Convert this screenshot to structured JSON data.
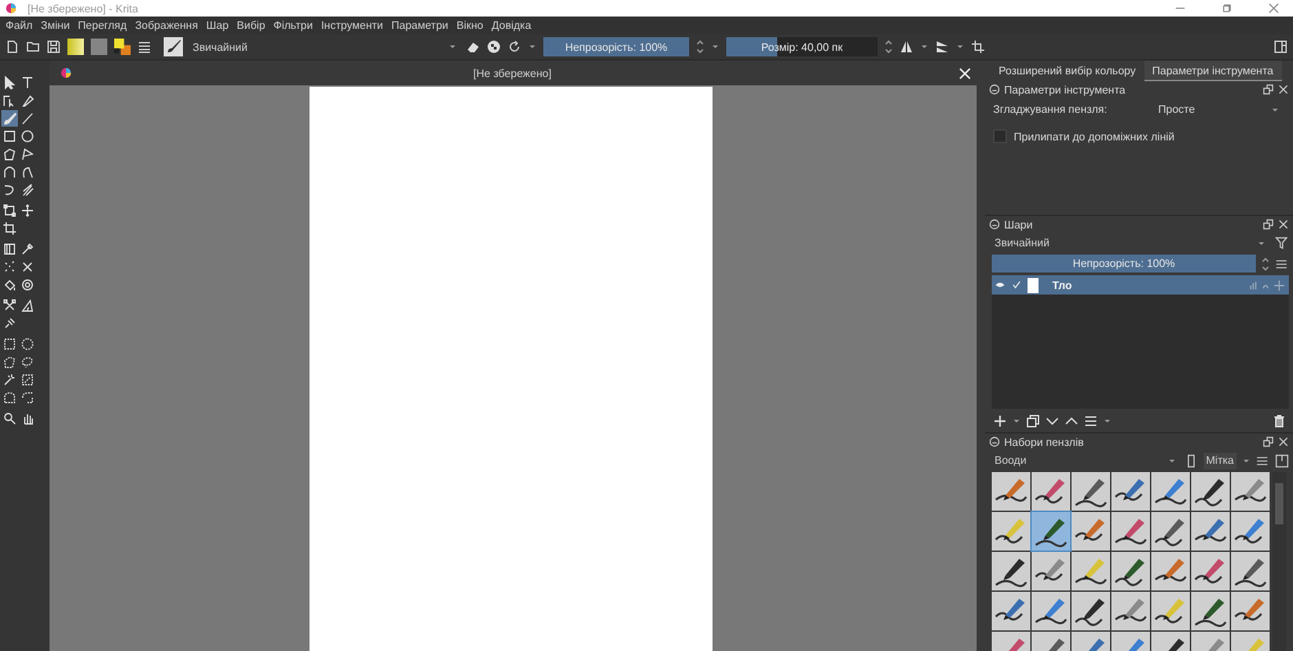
{
  "window": {
    "title": "[Не збережено] - Krita"
  },
  "menu": [
    "Файл",
    "Зміни",
    "Перегляд",
    "Зображення",
    "Шар",
    "Вибір",
    "Фільтри",
    "Інструменти",
    "Параметри",
    "Вікно",
    "Довідка"
  ],
  "toolbar": {
    "blend_mode": "Звичайний",
    "opacity": {
      "label": "Непрозорість: 100%",
      "level": 1
    },
    "size": {
      "label": "Розмір: 40,00 пк",
      "level": 0.34
    }
  },
  "toolbox": [
    [
      {
        "kind": "select",
        "selected": false
      },
      {
        "kind": "text",
        "selected": false
      },
      {
        "kind": "shape-edit",
        "selected": false
      },
      {
        "kind": "calligraphy",
        "selected": false
      },
      {
        "kind": "brush",
        "selected": true
      },
      {
        "kind": "line",
        "selected": false
      },
      {
        "kind": "rect",
        "selected": false
      },
      {
        "kind": "ellipse",
        "selected": false
      },
      {
        "kind": "polygon",
        "selected": false
      },
      {
        "kind": "polyline",
        "selected": false
      },
      {
        "kind": "bezier",
        "selected": false
      },
      {
        "kind": "freehand-path",
        "selected": false
      },
      {
        "kind": "dynabrush",
        "selected": false
      },
      {
        "kind": "multibrush",
        "selected": false
      }
    ],
    [
      {
        "kind": "transform",
        "selected": false
      },
      {
        "kind": "move",
        "selected": false
      },
      {
        "kind": "crop",
        "selected": false
      }
    ],
    [
      {
        "kind": "gradient",
        "selected": false
      },
      {
        "kind": "picker",
        "selected": false
      },
      {
        "kind": "colorize",
        "selected": false
      },
      {
        "kind": "smart-patch",
        "selected": false
      },
      {
        "kind": "fill",
        "selected": false
      },
      {
        "kind": "enclose",
        "selected": false
      }
    ],
    [
      {
        "kind": "assistant",
        "selected": false
      },
      {
        "kind": "measure",
        "selected": false
      },
      {
        "kind": "reference",
        "selected": false
      }
    ],
    [
      {
        "kind": "rect-select",
        "selected": false
      },
      {
        "kind": "ellipse-select",
        "selected": false
      },
      {
        "kind": "poly-select",
        "selected": false
      },
      {
        "kind": "free-select",
        "selected": false
      },
      {
        "kind": "contiguous-select",
        "selected": false
      },
      {
        "kind": "similar-select",
        "selected": false
      },
      {
        "kind": "bezier-select",
        "selected": false
      },
      {
        "kind": "magnetic-select",
        "selected": false
      }
    ],
    [
      {
        "kind": "zoom",
        "selected": false
      },
      {
        "kind": "pan",
        "selected": false
      }
    ]
  ],
  "document_tab": {
    "title": "[Не збережено]"
  },
  "dock_tabs": [
    {
      "label": "Розширений вибір кольору",
      "selected": false
    },
    {
      "label": "Параметри інструмента",
      "selected": true
    }
  ],
  "tool_options": {
    "title": "Параметри інструмента",
    "smoothing_label": "Згладжування пензля:",
    "smoothing_value": "Просте",
    "snap": {
      "label": "Прилипати до допоміжних ліній",
      "checked": false
    }
  },
  "layers": {
    "title": "Шари",
    "blend_mode": "Звичайний",
    "opacity": {
      "label": "Непрозорість:  100%",
      "level": 1
    },
    "items": [
      {
        "name": "Тло",
        "visible": true,
        "checked": true,
        "selected": true
      }
    ]
  },
  "brush_presets": {
    "title": "Набори пензлів",
    "tag": "Вооди",
    "tag_label": "Мітка",
    "presets": [
      {
        "selected": false
      },
      {
        "selected": false
      },
      {
        "selected": false
      },
      {
        "selected": false
      },
      {
        "selected": false
      },
      {
        "selected": false
      },
      {
        "selected": false
      },
      {
        "selected": false
      },
      {
        "selected": true
      },
      {
        "selected": false
      },
      {
        "selected": false
      },
      {
        "selected": false
      },
      {
        "selected": false
      },
      {
        "selected": false
      },
      {
        "selected": false
      },
      {
        "selected": false
      },
      {
        "selected": false
      },
      {
        "selected": false
      },
      {
        "selected": false
      },
      {
        "selected": false
      },
      {
        "selected": false
      },
      {
        "selected": false
      },
      {
        "selected": false
      },
      {
        "selected": false
      },
      {
        "selected": false
      },
      {
        "selected": false
      },
      {
        "selected": false
      },
      {
        "selected": false
      },
      {
        "selected": false
      },
      {
        "selected": false
      },
      {
        "selected": false
      },
      {
        "selected": false
      },
      {
        "selected": false
      },
      {
        "selected": false
      },
      {
        "selected": false
      }
    ]
  }
}
